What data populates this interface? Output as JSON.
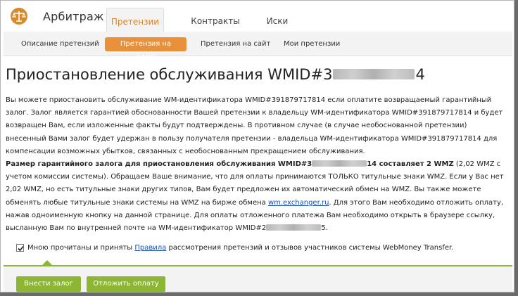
{
  "header": {
    "app_title": "Арбитраж",
    "tabs": [
      {
        "label": "Претензии",
        "active": true
      },
      {
        "label": "Контракты",
        "active": false
      },
      {
        "label": "Иски",
        "active": false
      }
    ],
    "logo_icon": "scales-icon"
  },
  "subnav": {
    "items": [
      {
        "label": "Описание претензий",
        "active": false
      },
      {
        "label": "Претензия на WMID",
        "active": true
      },
      {
        "label": "Претензия на сайт",
        "active": false
      },
      {
        "label": "Мои претензии",
        "active": false
      }
    ]
  },
  "page": {
    "title_prefix": "Приостановление обслуживания WMID#3",
    "title_suffix": "4",
    "p1": "Вы можете приостановить обслуживание WM-идентификатора WMID#391879717814 если оплатите возвращаемый гарантийный залог. Залог является гарантией обоснованности Вашей претензии к владельцу WM-идентификатора WMID#391879717814 и будет возвращен Вам, если изложенные факты будут подтверждены. В противном случае (в случае необоснованной претензии) внесенный Вами залог будет удержан в пользу получателя претензии - владельца WM-идентификатора WMID#391879717814 для компенсации возможных убытков, связанных с необоснованным прекращением обслуживания.",
    "p2_bold_prefix": "Размер гарантийного залога для приостановления обслуживания WMID#3",
    "p2_bold_suffix": "14 составляет 2 WMZ",
    "p2_text_a": " (2,02 WMZ с учетом комиссии системы). Обращаем Ваше внимание, что для оплаты принимаются ТОЛЬКО титульные знаки WMZ. Если у Вас нет 2,02 WMZ, но есть титульные знаки других типов, Вам будет предложен их автоматический обмен на WMZ. Вы также можете обменять любые титульные знаки системы на WMZ на бирже обмена ",
    "p2_link": "wm.exchanger.ru",
    "p2_text_b": ". Для этого Вам необходимо отложить оплату, нажав одноименную кнопку на данной странице. Для оплаты отложенного платежа Вам необходимо открыть в браузере ссылку, высланную Вам по внутренней почте на WM-идентификатор WMID#2",
    "p2_text_c": "5."
  },
  "agree": {
    "checked": true,
    "text_before": "Мною прочитаны и приняты ",
    "link": "Правила",
    "text_after": " рассмотрения претензий и отзывов участников системы WebMoney Transfer."
  },
  "buttons": {
    "pay_label": "Внести залог",
    "defer_label": "Отложить оплату"
  },
  "colors": {
    "accent_orange": "#e8913a",
    "accent_green": "#8cb634",
    "link": "#1a4fa8"
  }
}
